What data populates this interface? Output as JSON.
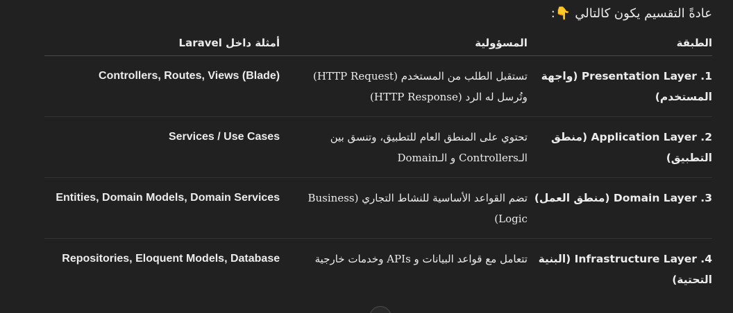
{
  "intro": {
    "text": "عادةً التقسيم يكون كالتالي",
    "emoji": "👇",
    "suffix": ":"
  },
  "table": {
    "headers": {
      "layer": "الطبقة",
      "responsibility": "المسؤولية",
      "examples": "أمثلة داخل Laravel"
    },
    "rows": [
      {
        "layer": "1. Presentation Layer (واجهة المستخدم)",
        "responsibility": "تستقبل الطلب من المستخدم (HTTP Request) وتُرسل له الرد (HTTP Response)",
        "examples": "Controllers, Routes, Views (Blade)"
      },
      {
        "layer": "2. Application Layer (منطق التطبيق)",
        "responsibility": "تحتوي على المنطق العام للتطبيق، وتنسق بين الـControllers و الـDomain",
        "examples": "Services / Use Cases"
      },
      {
        "layer": "3. Domain Layer (منطق العمل)",
        "responsibility": "تضم القواعد الأساسية للنشاط التجاري (Business Logic)",
        "examples": "Entities, Domain Models, Domain Services"
      },
      {
        "layer": "4. Infrastructure Layer (البنية التحتية)",
        "responsibility": "تتعامل مع قواعد البيانات و APIs وخدمات خارجية",
        "examples": "Repositories, Eloquent Models, Database"
      }
    ]
  },
  "icons": {
    "emoji": "pointing-down-hand-icon",
    "scroll": "scroll-down-button"
  }
}
